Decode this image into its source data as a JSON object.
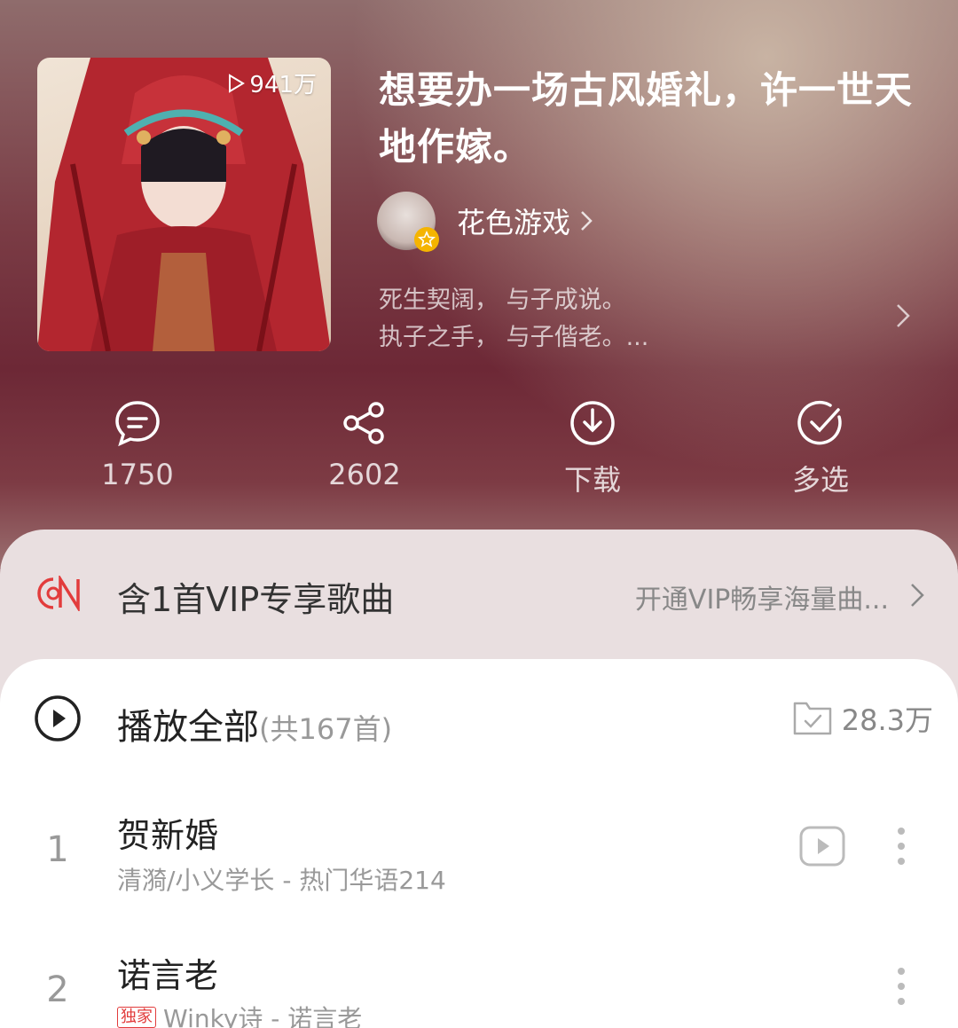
{
  "playlist": {
    "play_count": "941万",
    "title": "想要办一场古风婚礼，许一世天地作嫁。",
    "creator": "花色游戏",
    "description_line1": "死生契阔， 与子成说。",
    "description_line2": "执子之手， 与子偕老。..."
  },
  "actions": {
    "comments": "1750",
    "share": "2602",
    "download": "下载",
    "multiselect": "多选"
  },
  "vip": {
    "label": "含1首VIP专享歌曲",
    "cta": "开通VIP畅享海量曲..."
  },
  "list": {
    "play_all": "播放全部",
    "count": "(共167首)",
    "collect_count": "28.3万",
    "songs": [
      {
        "index": "1",
        "title": "贺新婚",
        "subtitle": "清漪/小义学长 - 热门华语214"
      },
      {
        "index": "2",
        "title": "诺言老",
        "tag": "独家",
        "subtitle": "Winky诗 - 诺言老"
      }
    ]
  },
  "colors": {
    "accent_red": "#e23c3c",
    "vip_badge": "#f5b400"
  }
}
